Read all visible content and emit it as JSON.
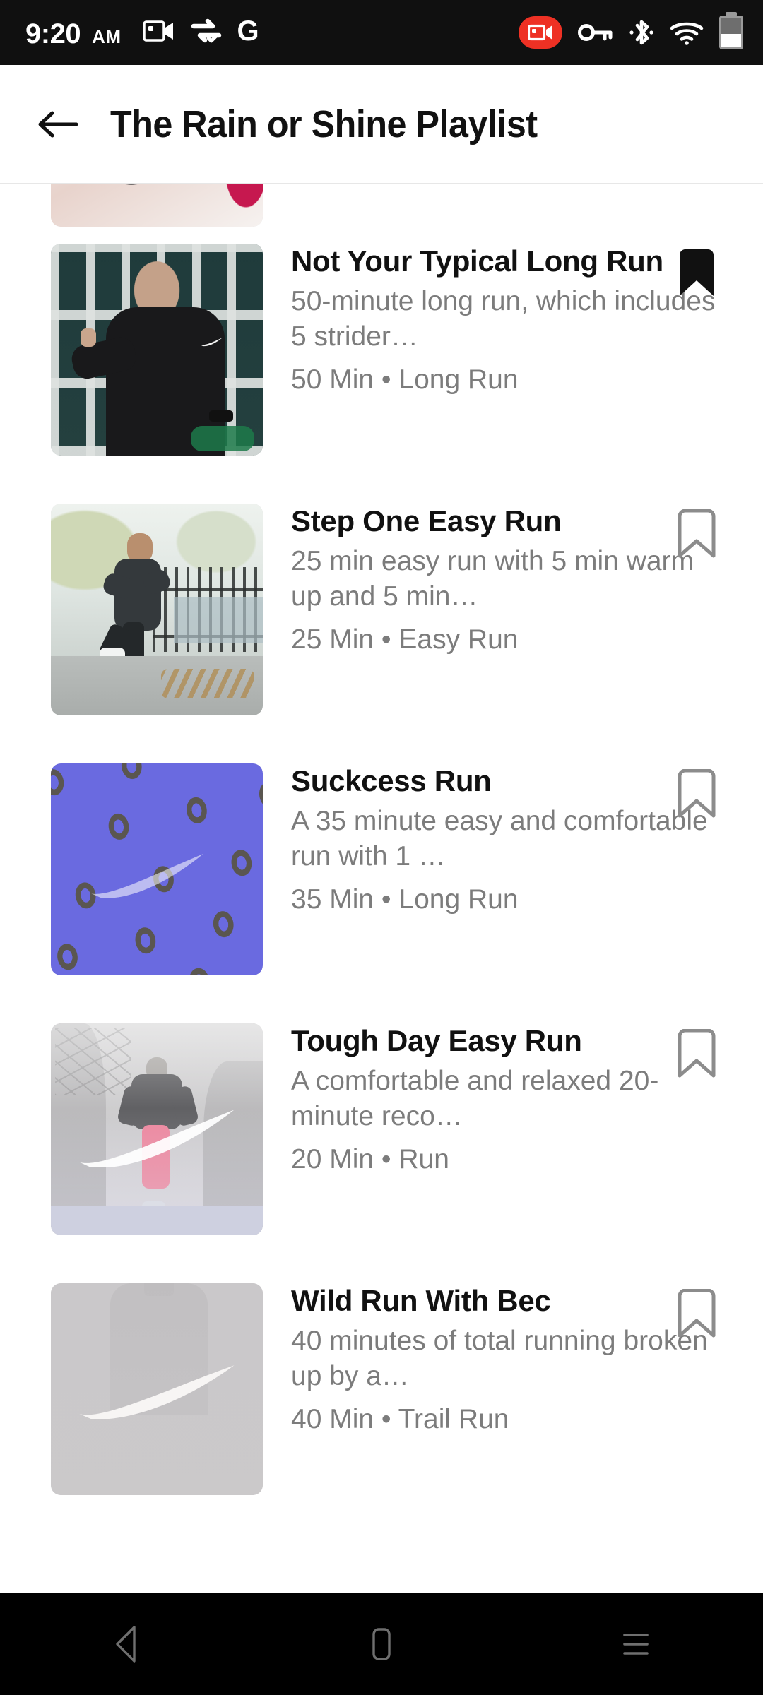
{
  "status_bar": {
    "time": "9:20",
    "ampm": "AM",
    "left_icons": [
      "screen-cast-video-icon",
      "vpn-data-transfer-icon",
      "google-g-icon"
    ],
    "google_letter": "G",
    "right_icons": [
      "screen-recording-badge",
      "vpn-key-icon",
      "bluetooth-icon",
      "wifi-icon",
      "battery-icon"
    ],
    "battery_level_percent": 55,
    "recording_color": "#ee3124",
    "background": "#101010"
  },
  "header": {
    "back_label": "Back",
    "title": "The Rain or Shine Playlist"
  },
  "list": {
    "partial_top_item": {
      "thumbnail": "cropped-runner-thumbnail"
    },
    "items": [
      {
        "title": "Not Your Typical Long Run",
        "description": "50-minute long run, which includes 5 strider…",
        "meta": "50 Min • Long Run",
        "duration": "50 Min",
        "category": "Long Run",
        "bookmarked": true,
        "bookmark_icon": "bookmark-filled-icon",
        "thumbnail": "coach-pointing-black-nike-tee"
      },
      {
        "title": "Step One Easy Run",
        "description": "25 min easy run with 5 min warm up and 5 min…",
        "meta": "25 Min • Easy Run",
        "duration": "25 Min",
        "category": "Easy Run",
        "bookmarked": false,
        "bookmark_icon": "bookmark-outline-icon",
        "thumbnail": "runner-on-path-by-fence"
      },
      {
        "title": "Suckcess Run",
        "description": "A 35 minute easy and comfortable run with 1 …",
        "meta": "35 Min • Long Run",
        "duration": "35 Min",
        "category": "Long Run",
        "bookmarked": false,
        "bookmark_icon": "bookmark-outline-icon",
        "thumbnail": "blue-zero-pattern-graphic"
      },
      {
        "title": "Tough Day Easy Run",
        "description": "A comfortable and relaxed 20-minute reco…",
        "meta": "20 Min • Run",
        "duration": "20 Min",
        "category": "Run",
        "bookmarked": false,
        "bookmark_icon": "bookmark-outline-icon",
        "thumbnail": "foggy-winter-runner-swoosh"
      },
      {
        "title": "Wild Run With Bec",
        "description": "40 minutes of total running broken up by a…",
        "meta": "40 Min • Trail Run",
        "duration": "40 Min",
        "category": "Trail Run",
        "bookmarked": false,
        "bookmark_icon": "bookmark-outline-icon",
        "thumbnail": "grey-swoosh-silhouette"
      }
    ]
  },
  "nav_bar": {
    "buttons": [
      "back-nav-icon",
      "home-nav-icon",
      "recents-nav-icon"
    ],
    "background": "#000000"
  },
  "colors": {
    "page_background": "#ffffff",
    "title_text": "#111111",
    "secondary_text": "#7c7c7c",
    "bookmark_outline": "#8c8c8c",
    "bookmark_filled": "#111111",
    "divider": "#e7e7e7"
  }
}
